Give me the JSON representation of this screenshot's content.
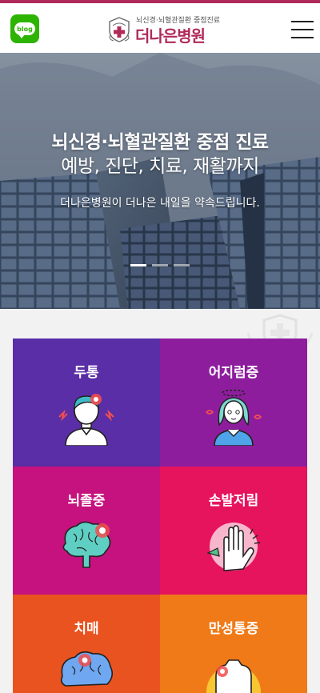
{
  "header": {
    "blog_label": "blog",
    "logo_tagline": "뇌신경·뇌혈관질환 중점진료",
    "logo_name": "더나은병원"
  },
  "hero": {
    "title": "뇌신경·뇌혈관질환 중점 진료",
    "subtitle": "예방, 진단, 치료, 재활까지",
    "promise": "더나은병원이 더나은 내일을 약속드립니다.",
    "slides_total": 3,
    "active_slide": 1
  },
  "departments": [
    {
      "label": "두통",
      "color": "#5a2ea6"
    },
    {
      "label": "어지럼증",
      "color": "#8e1d9e"
    },
    {
      "label": "뇌졸중",
      "color": "#c5127e"
    },
    {
      "label": "손발저림",
      "color": "#e6135d"
    },
    {
      "label": "치매",
      "color": "#e9531f"
    },
    {
      "label": "만성통증",
      "color": "#f07a18"
    }
  ]
}
